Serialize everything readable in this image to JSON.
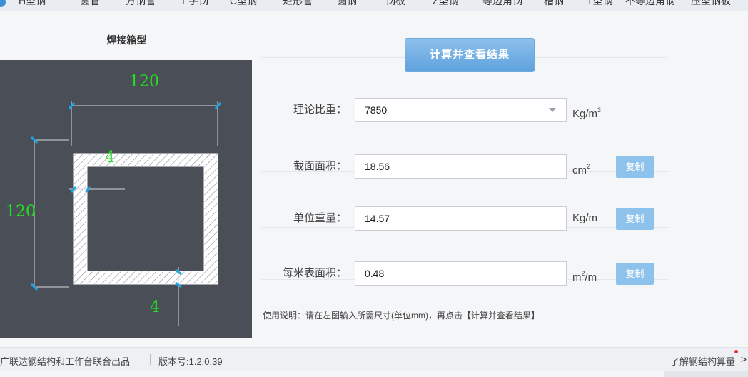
{
  "nav": {
    "items": [
      "H型钢",
      "圆管",
      "方钢管",
      "工字钢",
      "C型钢",
      "矩形管",
      "圆钢",
      "钢板",
      "Z型钢",
      "等边角钢",
      "槽钢",
      "T型钢",
      "不等边角钢",
      "压型钢板"
    ]
  },
  "diagram": {
    "title": "焊接箱型",
    "width_label": "120",
    "height_label": "120",
    "web_thickness_label": "4",
    "flange_thickness_label": "4",
    "dim_color": "#22e01f",
    "bg_color": "#4a4f57"
  },
  "calc_button": {
    "label": "计算并查看结果"
  },
  "rows": [
    {
      "label": "理论比重：",
      "value": "7850",
      "unit_base": "Kg/m",
      "unit_sup": "3",
      "has_copy": false,
      "is_select": true
    },
    {
      "label": "截面面积：",
      "value": "18.56",
      "unit_base": "cm",
      "unit_sup": "2",
      "has_copy": true
    },
    {
      "label": "单位重量：",
      "value": "14.57",
      "unit_base": "Kg/m",
      "unit_sup": "",
      "has_copy": true
    },
    {
      "label": "每米表面积：",
      "value": "0.48",
      "unit_base": "m",
      "unit_sup": "2",
      "unit_tail": "/m",
      "has_copy": true
    }
  ],
  "copy_label": "复制",
  "instructions": "使用说明：请在左图输入所需尺寸(单位mm)，再点击【计算并查看结果】",
  "footer": {
    "credit": "广联达钢结构和工作台联合出品",
    "version": "版本号:1.2.0.39",
    "learn": "了解钢结构算量",
    "chevron": ">"
  },
  "colors": {
    "accent": "#5ea2de",
    "copy_button": "#8cc2ec"
  }
}
